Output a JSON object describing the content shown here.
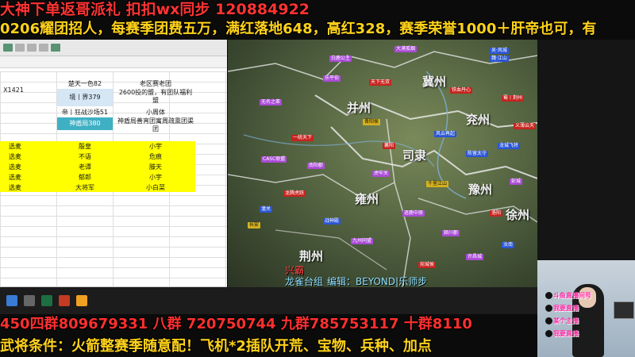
{
  "banners": {
    "top1": "大神下单返哥派礼 扣扣wx同步 120884922",
    "top2": "0206耀团招人，每赛季团费五万，满红落地648，高红328，赛季荣誉1000＋肝帝也可，有",
    "bottom1": "450四群809679331 八群 720750744 九群785753117   十群8110",
    "bottom2": "武将条件：火箭整赛季随意配！飞机*2插队开荒、宝物、兵种、加点"
  },
  "sheet": {
    "row_id": "X1421",
    "header_a": "楚天一色82",
    "header_b": "老区赛老团",
    "r1_a": "境丨界379",
    "r1_b": "2600投的盟，有团队福利盟",
    "r2_a": "帝丨狂战沙场51",
    "r2_b": "小周体",
    "r3_a": "神盾局380",
    "r3_b": "神盾局善宵团寓周疏熏团渠团",
    "yellow_rows": [
      {
        "label": "选麦",
        "name": "殷皇",
        "right": "小宇"
      },
      {
        "label": "选麦",
        "name": "不语",
        "right": "危痕"
      },
      {
        "label": "选麦",
        "name": "老谭",
        "right": "滕天"
      },
      {
        "label": "选麦",
        "name": "郁郎",
        "right": "小宇"
      },
      {
        "label": "选麦",
        "name": "大将军",
        "right": "小白菜"
      }
    ]
  },
  "map": {
    "regions": [
      "并州",
      "冀州",
      "兖州",
      "司隶",
      "豫州",
      "雍州",
      "徐州",
      "荆州"
    ],
    "cities": [
      {
        "t": "白鹿公主",
        "c": "p"
      },
      {
        "t": "天下无双",
        "c": "r"
      },
      {
        "t": "大漠孤烟",
        "c": "p"
      },
      {
        "t": "吴·风城",
        "c": "b"
      },
      {
        "t": "蜀丨荆州",
        "c": "r"
      },
      {
        "t": "魏·江山",
        "c": "b"
      },
      {
        "t": "乐平伯",
        "c": "p"
      },
      {
        "t": "晋阳侯",
        "c": "y"
      },
      {
        "t": "无名之辈",
        "c": "p"
      },
      {
        "t": "义薄云天",
        "c": "r"
      },
      {
        "t": "风云再起",
        "c": "b"
      },
      {
        "t": "CASC联盟",
        "c": "p"
      },
      {
        "t": "龙腾虎跃",
        "c": "r"
      },
      {
        "t": "陈留太守",
        "c": "b"
      },
      {
        "t": "虎牢关",
        "c": "p"
      },
      {
        "t": "千里江山",
        "c": "y"
      },
      {
        "t": "一统天下",
        "c": "r"
      },
      {
        "t": "逐鹿中原",
        "c": "p"
      },
      {
        "t": "战神殿",
        "c": "b"
      },
      {
        "t": "洛阳",
        "c": "r"
      },
      {
        "t": "颍川郡",
        "c": "p"
      },
      {
        "t": "汝南",
        "c": "b"
      },
      {
        "t": "许昌城",
        "c": "p"
      },
      {
        "t": "宛城侯",
        "c": "r"
      },
      {
        "t": "长安",
        "c": "y"
      },
      {
        "t": "九州同盟",
        "c": "p"
      },
      {
        "t": "潼关",
        "c": "b"
      },
      {
        "t": "襄阳",
        "c": "r"
      },
      {
        "t": "南阳郡",
        "c": "p"
      },
      {
        "t": "龙城飞将",
        "c": "b"
      },
      {
        "t": "铁血丹心",
        "c": "r"
      },
      {
        "t": "彭城",
        "c": "p"
      }
    ],
    "caption_left": "兴霸",
    "caption_main": "龙雀台组",
    "caption_right": "编辑：BEYOND|乐师步"
  },
  "cam": {
    "tag1": "斗鱼直播间号",
    "tag2": "我要直播",
    "tag3": "某个主播",
    "tag4": "我要直播"
  }
}
